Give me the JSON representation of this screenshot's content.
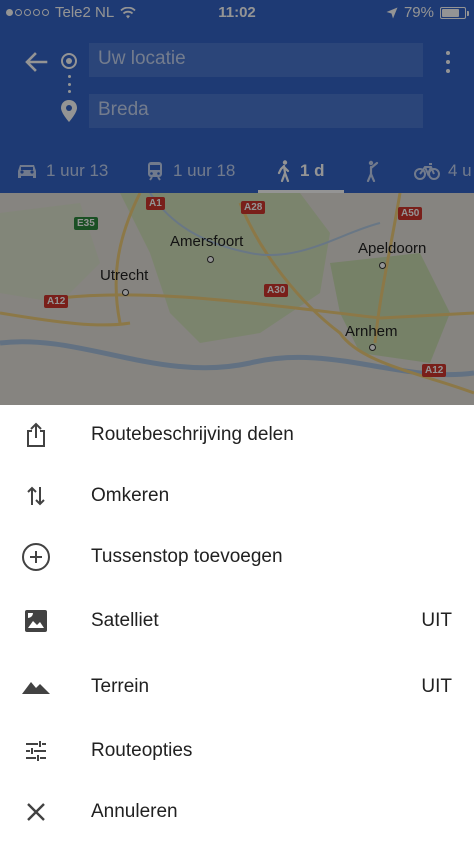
{
  "status_bar": {
    "carrier": "Tele2 NL",
    "time": "11:02",
    "battery": "79%",
    "battery_level": 0.79,
    "signal_bars_filled": 1,
    "signal_bars_total": 5
  },
  "search": {
    "origin_value": "Uw locatie",
    "destination_value": "Breda"
  },
  "travel_modes": [
    {
      "id": "car",
      "icon": "car-icon",
      "label": "1 uur 13"
    },
    {
      "id": "transit",
      "icon": "train-icon",
      "label": "1 uur 18"
    },
    {
      "id": "walk",
      "icon": "walk-icon",
      "label": "1 d",
      "active": true
    },
    {
      "id": "ride",
      "icon": "hail-icon",
      "label": ""
    },
    {
      "id": "bike",
      "icon": "bike-icon",
      "label": "4 u"
    }
  ],
  "map": {
    "cities": [
      "Amersfoort",
      "Apeldoorn",
      "Utrecht",
      "Arnhem"
    ],
    "roads": [
      "A1",
      "A28",
      "A50",
      "E35",
      "A30",
      "A12",
      "A12"
    ]
  },
  "menu": {
    "items": [
      {
        "icon": "share-icon",
        "label": "Routebeschrijving delen",
        "value": ""
      },
      {
        "icon": "swap-icon",
        "label": "Omkeren",
        "value": ""
      },
      {
        "icon": "add-stop-icon",
        "label": "Tussenstop toevoegen",
        "value": ""
      },
      {
        "icon": "satellite-icon",
        "label": "Satelliet",
        "value": "UIT"
      },
      {
        "icon": "terrain-icon",
        "label": "Terrein",
        "value": "UIT"
      },
      {
        "icon": "tune-icon",
        "label": "Routeopties",
        "value": ""
      },
      {
        "icon": "close-icon",
        "label": "Annuleren",
        "value": ""
      }
    ]
  },
  "colors": {
    "header_blue": "#3565c9",
    "field_blue": "#4b77d1",
    "map_land": "#e7e4dc",
    "map_green": "#cfe2b4",
    "road_red": "#d0362d",
    "road_green": "#2e8b3e"
  }
}
